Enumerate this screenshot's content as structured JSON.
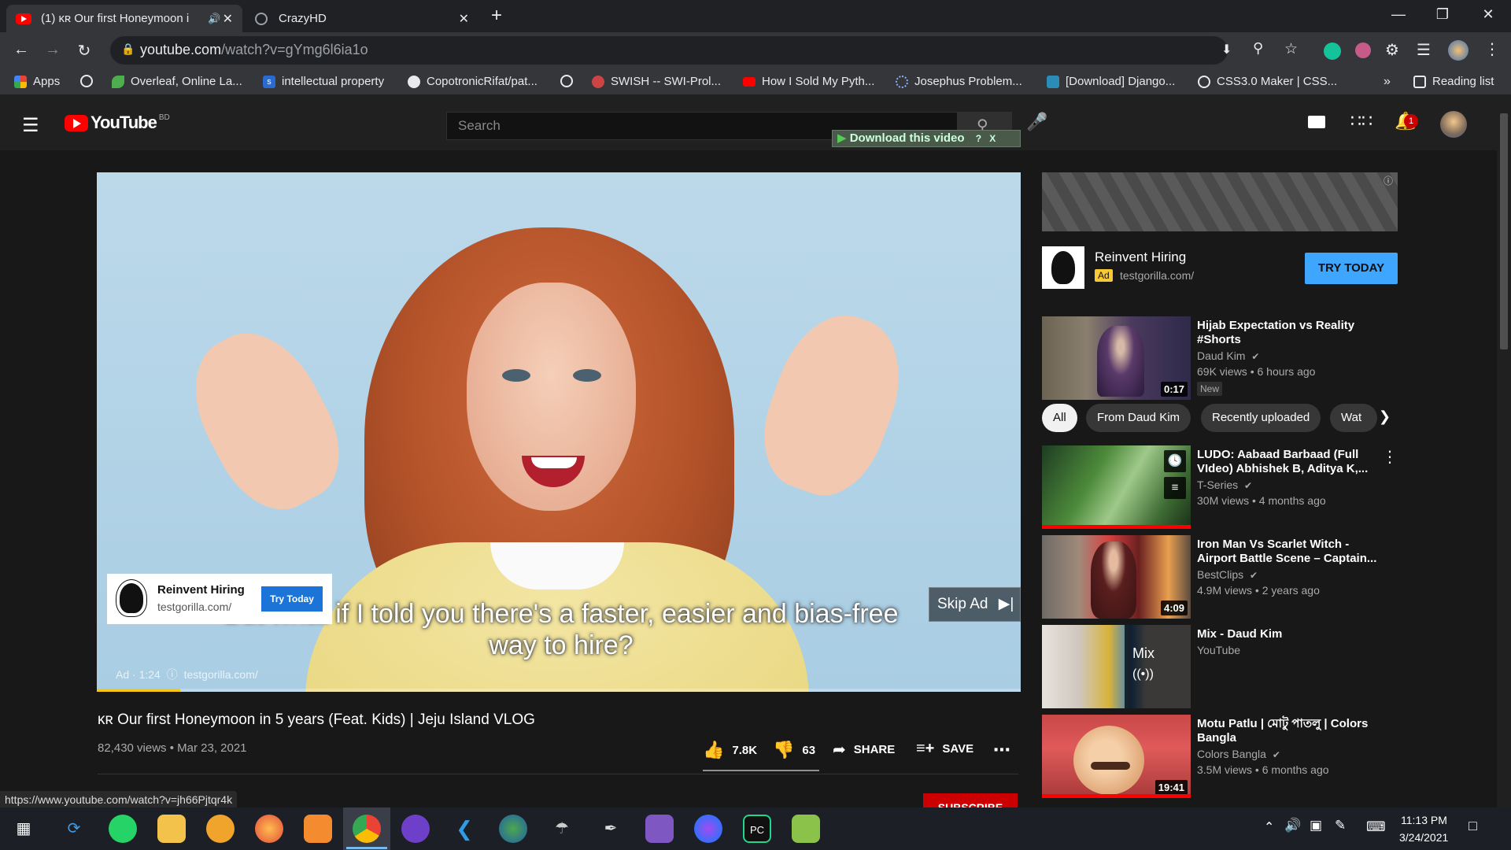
{
  "browser": {
    "tabs": [
      {
        "title": "(1) κʀ Our first Honeymoon i",
        "active": true
      },
      {
        "title": "CrazyHD",
        "active": false
      }
    ],
    "new_tab": "+",
    "url_domain": "youtube.com",
    "url_path": "/watch?v=gYmg6l6ia1o",
    "bookmarks": [
      "Apps",
      "Overleaf, Online La...",
      "intellectual property",
      "CopotronicRifat/pat...",
      "SWISH -- SWI-Prol...",
      "How I Sold My Pyth...",
      "Josephus Problem...",
      "[Download] Django...",
      "CSS3.0 Maker | CSS..."
    ],
    "overflow": "»",
    "reading_list": "Reading list",
    "status_url": "https://www.youtube.com/watch?v=jh66Pjtqr4k"
  },
  "youtube": {
    "logo": "YouTube",
    "country": "BD",
    "search_placeholder": "Search",
    "download_bar": "Download this video",
    "download_bar_help": "?",
    "download_bar_close": "X",
    "notif_count": "1"
  },
  "player": {
    "ad_card": {
      "title": "Reinvent Hiring",
      "url": "testgorilla.com/",
      "button": "Try Today"
    },
    "skip_label": "Skip Ad",
    "subtitle_line1": "But what if I told you there's a faster, easier and bias-free",
    "subtitle_line2": "way to hire?",
    "ad_info": "Ad · 1:24",
    "ad_info_url": "testgorilla.com/",
    "progress": 0.09
  },
  "video": {
    "title": "κʀ Our first Honeymoon in 5 years (Feat. Kids) | Jeju Island VLOG",
    "views_date": "82,430 views • Mar 23, 2021",
    "likes": "7.8K",
    "dislikes": "63",
    "share": "SHARE",
    "save": "SAVE",
    "subscribe": "SUBSCRIBE"
  },
  "sidebar_ad": {
    "title": "Reinvent Hiring",
    "badge": "Ad",
    "url": "testgorilla.com/",
    "button": "TRY TODAY"
  },
  "chips": [
    "All",
    "From Daud Kim",
    "Recently uploaded",
    "Wat"
  ],
  "recommendations": [
    {
      "title": "Hijab Expectation vs Reality #Shorts",
      "channel": "Daud Kim",
      "meta": "69K views • 6 hours ago",
      "duration": "0:17",
      "badge": "New"
    },
    {
      "title": "LUDO: Aabaad Barbaad (Full VIdeo) Abhishek B, Aditya K,...",
      "channel": "T-Series",
      "meta": "30M views • 4 months ago",
      "duration": ""
    },
    {
      "title": "Iron Man Vs Scarlet Witch - Airport Battle Scene – Captain...",
      "channel": "BestClips",
      "meta": "4.9M views • 2 years ago",
      "duration": "4:09"
    },
    {
      "title": "Mix - Daud Kim",
      "channel": "YouTube",
      "meta": "",
      "duration": "",
      "mix_label": "Mix"
    },
    {
      "title": "Motu Patlu | মোটু পাতলু | Colors Bangla",
      "channel": "Colors Bangla",
      "meta": "3.5M views • 6 months ago",
      "duration": "19:41"
    }
  ],
  "taskbar": {
    "time": "11:13 PM",
    "date": "3/24/2021"
  }
}
